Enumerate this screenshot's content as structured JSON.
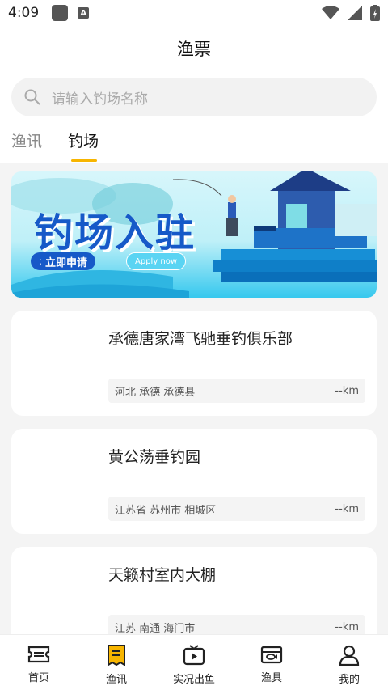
{
  "status_bar": {
    "time": "4:09",
    "notification_letter": "A"
  },
  "header": {
    "title": "渔票"
  },
  "search": {
    "placeholder": "请输入钓场名称"
  },
  "tabs": [
    {
      "label": "渔讯",
      "active": false
    },
    {
      "label": "钓场",
      "active": true
    }
  ],
  "banner": {
    "title": "钓场入驻",
    "cta": "立即申请",
    "cta_en": "Apply now"
  },
  "venues": [
    {
      "name": "承德唐家湾飞驰垂钓俱乐部",
      "location": "河北 承德 承德县",
      "distance": "--km"
    },
    {
      "name": "黄公荡垂钓园",
      "location": "江苏省 苏州市 相城区",
      "distance": "--km"
    },
    {
      "name": "天籁村室内大棚",
      "location": "江苏 南通 海门市",
      "distance": "--km"
    }
  ],
  "bottom_nav": [
    {
      "label": "首页",
      "icon": "ticket-icon",
      "active": false
    },
    {
      "label": "渔讯",
      "icon": "news-icon",
      "active": true
    },
    {
      "label": "实况出鱼",
      "icon": "tv-play-icon",
      "active": false
    },
    {
      "label": "渔具",
      "icon": "tackle-box-icon",
      "active": false
    },
    {
      "label": "我的",
      "icon": "user-icon",
      "active": false
    }
  ],
  "colors": {
    "accent": "#f7b500",
    "banner_blue": "#1659c8"
  }
}
